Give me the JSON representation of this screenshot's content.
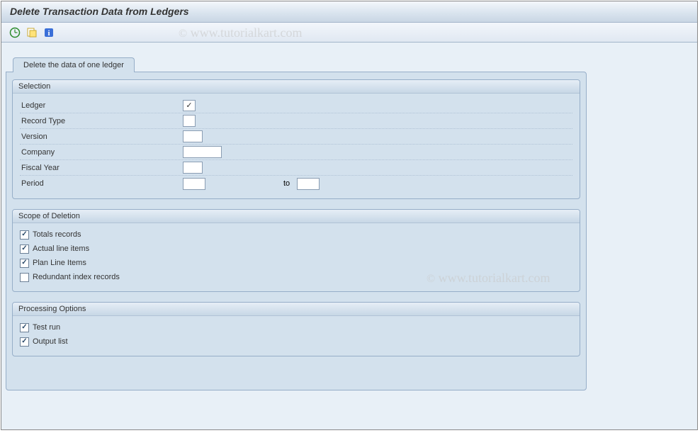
{
  "title": "Delete Transaction Data from Ledgers",
  "toolbar": {
    "icons": [
      "execute-icon",
      "variant-icon",
      "info-icon"
    ]
  },
  "tab": {
    "label": "Delete the data of one ledger"
  },
  "groups": {
    "selection": {
      "title": "Selection",
      "fields": {
        "ledger": {
          "label": "Ledger",
          "value": "",
          "checked": true
        },
        "record_type": {
          "label": "Record Type",
          "value": ""
        },
        "version": {
          "label": "Version",
          "value": ""
        },
        "company": {
          "label": "Company",
          "value": ""
        },
        "fiscal_year": {
          "label": "Fiscal Year",
          "value": ""
        },
        "period": {
          "label": "Period",
          "value_from": "",
          "to_label": "to",
          "value_to": ""
        }
      }
    },
    "scope": {
      "title": "Scope of Deletion",
      "items": [
        {
          "label": "Totals records",
          "checked": true
        },
        {
          "label": "Actual line items",
          "checked": true
        },
        {
          "label": "Plan Line Items",
          "checked": true
        },
        {
          "label": "Redundant index records",
          "checked": false
        }
      ]
    },
    "processing": {
      "title": "Processing Options",
      "items": [
        {
          "label": "Test run",
          "checked": true
        },
        {
          "label": "Output list",
          "checked": true
        }
      ]
    }
  },
  "watermark": "www.tutorialkart.com",
  "watermark_c": "©"
}
